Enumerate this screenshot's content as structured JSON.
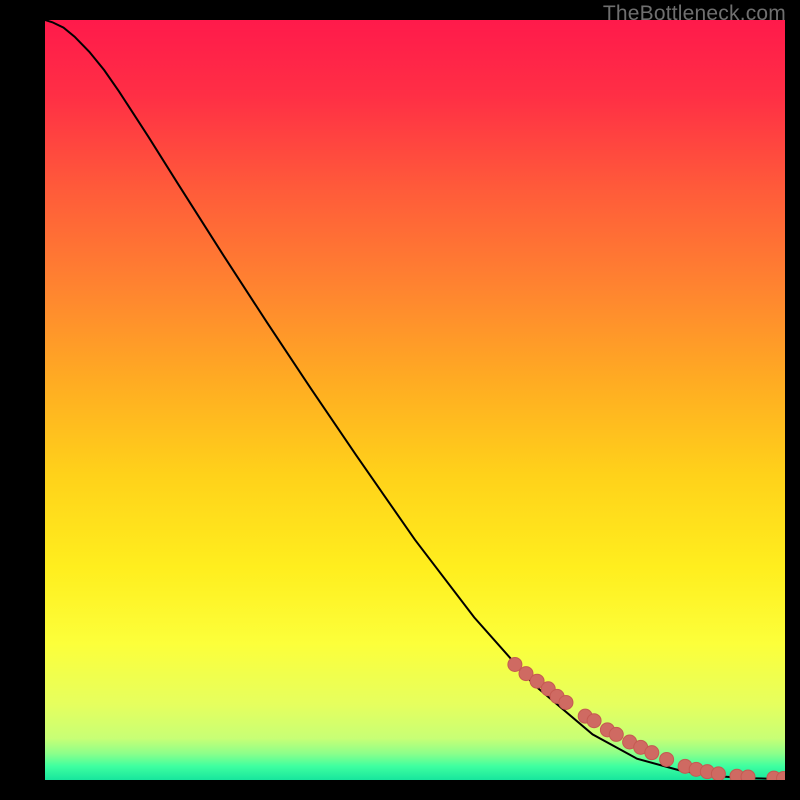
{
  "watermark": "TheBottleneck.com",
  "colors": {
    "background": "#000000",
    "gradient_stops": [
      {
        "offset": 0.0,
        "color": "#ff1a4b"
      },
      {
        "offset": 0.1,
        "color": "#ff2f45"
      },
      {
        "offset": 0.22,
        "color": "#ff5a3a"
      },
      {
        "offset": 0.35,
        "color": "#ff8330"
      },
      {
        "offset": 0.48,
        "color": "#ffad22"
      },
      {
        "offset": 0.6,
        "color": "#ffd21a"
      },
      {
        "offset": 0.72,
        "color": "#ffee1e"
      },
      {
        "offset": 0.82,
        "color": "#fcff3a"
      },
      {
        "offset": 0.9,
        "color": "#e6ff5e"
      },
      {
        "offset": 0.945,
        "color": "#c8ff75"
      },
      {
        "offset": 0.965,
        "color": "#8dff8a"
      },
      {
        "offset": 0.982,
        "color": "#3effa0"
      },
      {
        "offset": 1.0,
        "color": "#17e59d"
      }
    ],
    "curve": "#000000",
    "marker_fill": "#cf6a62",
    "marker_stroke": "#c55a52"
  },
  "chart_data": {
    "type": "line",
    "title": "",
    "xlabel": "",
    "ylabel": "",
    "xlim": [
      0,
      100
    ],
    "ylim": [
      0,
      100
    ],
    "grid": false,
    "series": [
      {
        "name": "curve",
        "kind": "line",
        "x": [
          0.0,
          1.0,
          2.5,
          4.0,
          6.0,
          8.0,
          10.0,
          14.0,
          18.0,
          24.0,
          30.0,
          36.0,
          42.0,
          50.0,
          58.0,
          66.0,
          74.0,
          80.0,
          86.0,
          90.0,
          92.0,
          94.0,
          96.0,
          98.0,
          100.0
        ],
        "y": [
          100.0,
          99.7,
          99.0,
          97.8,
          95.8,
          93.4,
          90.6,
          84.6,
          78.4,
          69.2,
          60.2,
          51.4,
          42.8,
          31.6,
          21.4,
          12.6,
          6.0,
          2.8,
          1.2,
          0.6,
          0.42,
          0.3,
          0.22,
          0.16,
          0.12
        ]
      },
      {
        "name": "markers",
        "kind": "scatter",
        "x": [
          63.5,
          65.0,
          66.5,
          68.0,
          69.2,
          70.4,
          73.0,
          74.2,
          76.0,
          77.2,
          79.0,
          80.5,
          82.0,
          84.0,
          86.5,
          88.0,
          89.5,
          91.0,
          93.5,
          95.0,
          98.5,
          99.8
        ],
        "y": [
          15.2,
          14.0,
          13.0,
          12.0,
          11.0,
          10.2,
          8.4,
          7.8,
          6.6,
          6.0,
          5.0,
          4.3,
          3.6,
          2.7,
          1.8,
          1.4,
          1.1,
          0.8,
          0.5,
          0.4,
          0.25,
          0.2
        ]
      }
    ]
  }
}
